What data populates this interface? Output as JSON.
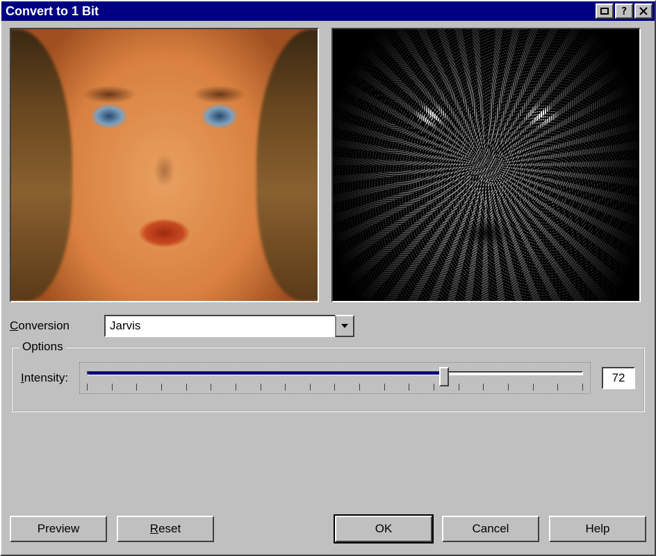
{
  "window": {
    "title": "Convert to 1 Bit"
  },
  "conversion": {
    "label": "Conversion",
    "label_accel": "C",
    "value": "Jarvis"
  },
  "options": {
    "legend": "Options",
    "intensity_label": "Intensity:",
    "intensity_accel": "I",
    "intensity_value": 72,
    "intensity_min": 0,
    "intensity_max": 100,
    "tick_count": 21
  },
  "buttons": {
    "preview": "Preview",
    "reset": "Reset",
    "reset_accel": "R",
    "ok": "OK",
    "cancel": "Cancel",
    "help": "Help"
  },
  "titlebar_icons": {
    "restore": "restore-icon",
    "help": "help-icon",
    "close": "close-icon"
  }
}
